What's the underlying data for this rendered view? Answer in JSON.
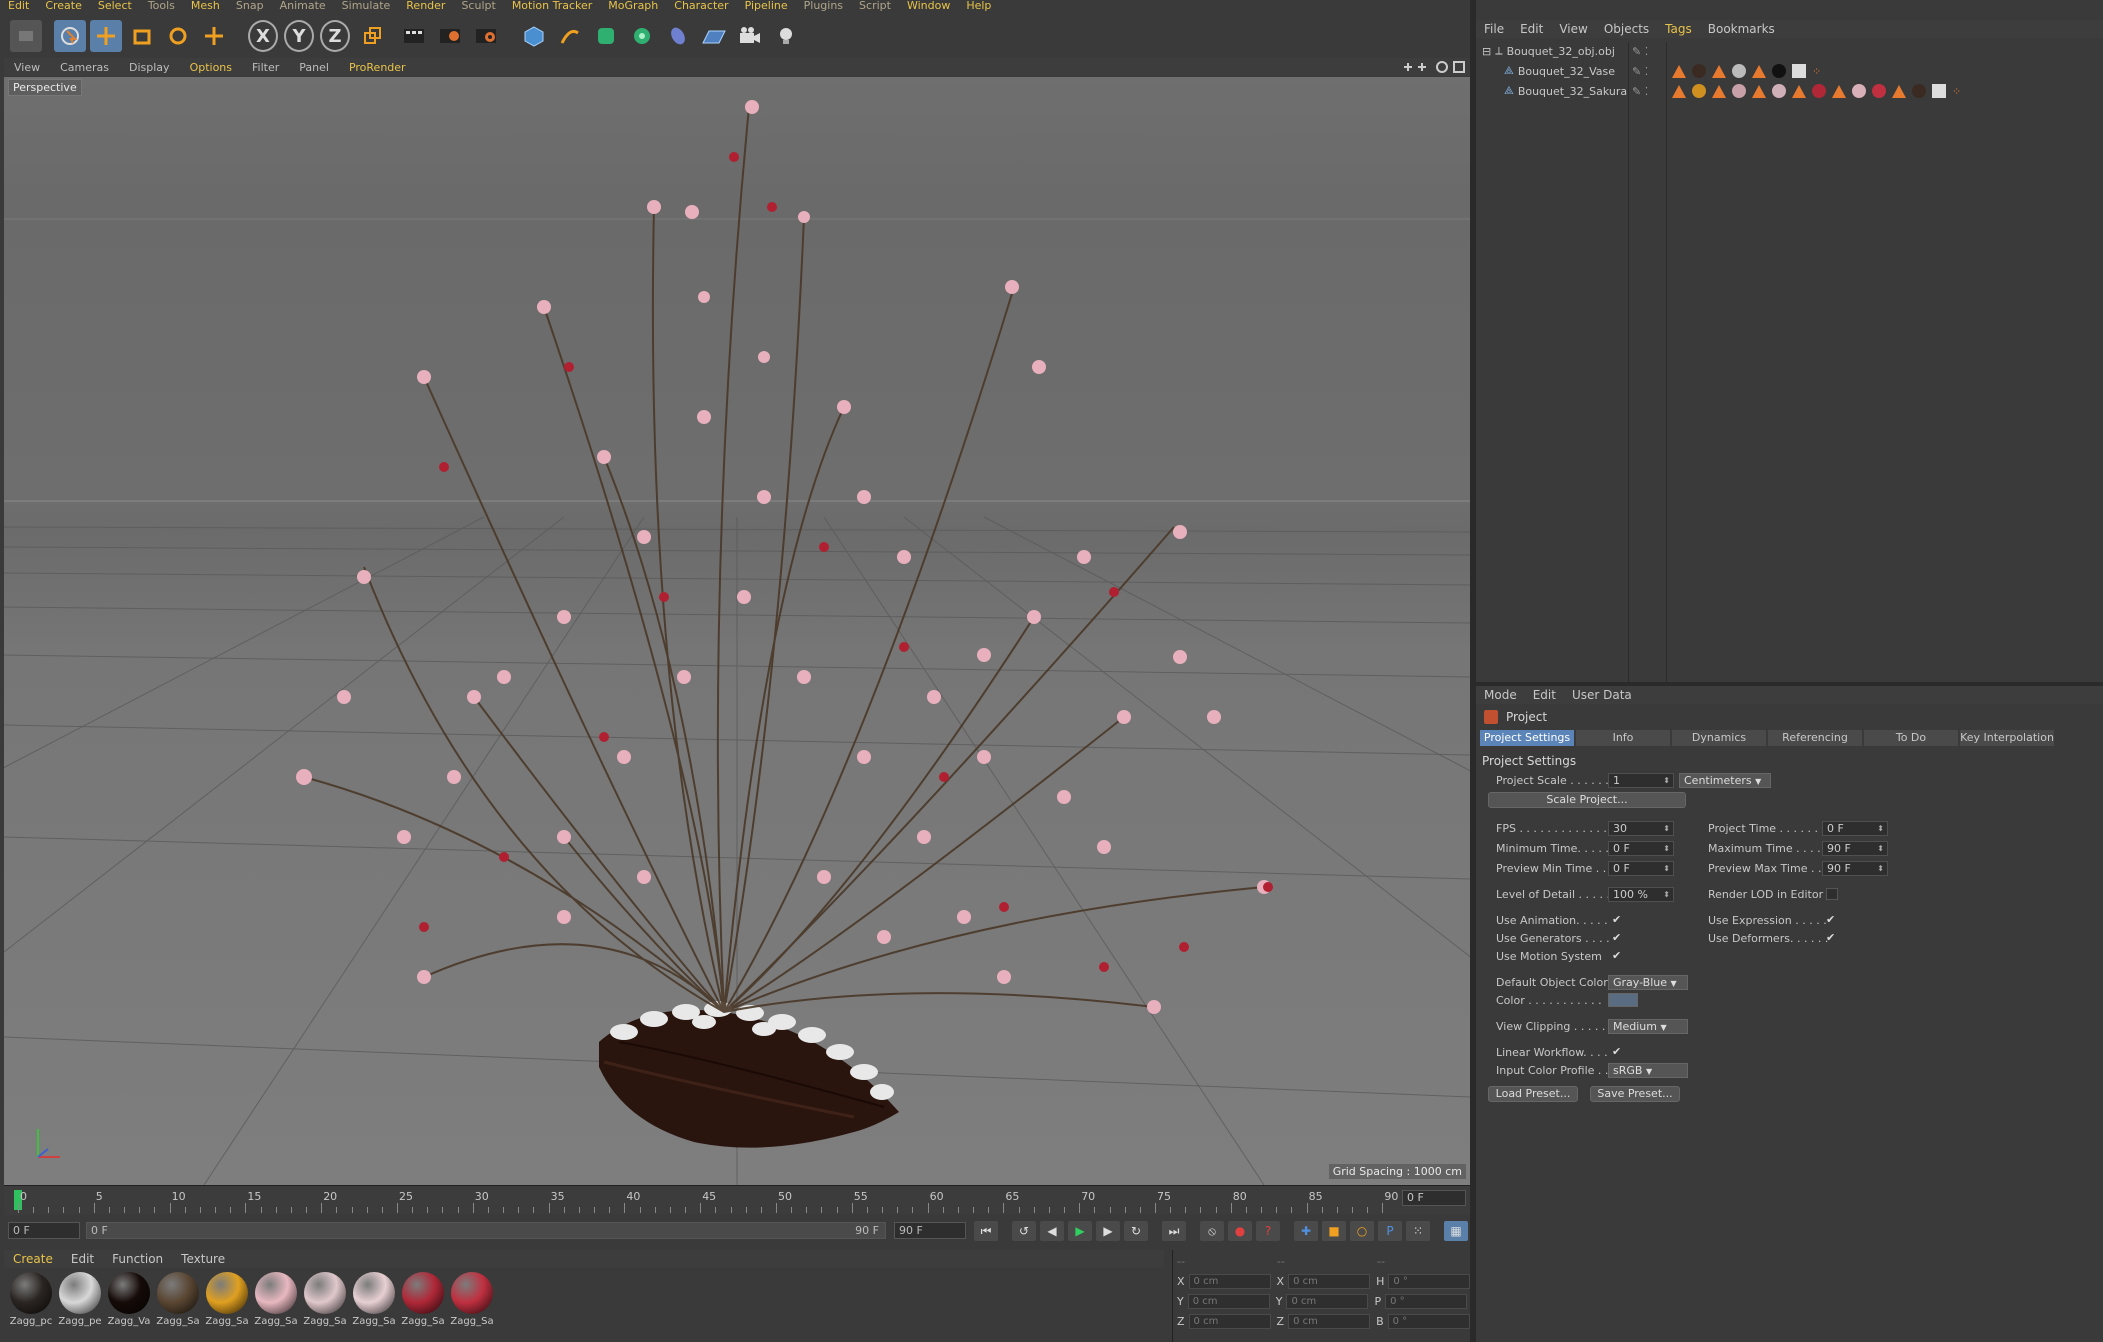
{
  "menu": [
    "Edit",
    "Create",
    "Select",
    "Tools",
    "Mesh",
    "Snap",
    "Animate",
    "Simulate",
    "Render",
    "Sculpt",
    "Motion Tracker",
    "MoGraph",
    "Character",
    "Pipeline",
    "Plugins",
    "Script",
    "Window",
    "Help"
  ],
  "toolbar": {
    "axis_x": "X",
    "axis_y": "Y",
    "axis_z": "Z"
  },
  "viewport": {
    "menu": [
      "View",
      "Cameras",
      "Display",
      "Options",
      "Filter",
      "Panel",
      "ProRender"
    ],
    "label": "Perspective",
    "grid_spacing": "Grid Spacing : 1000 cm"
  },
  "timeline": {
    "ticks": [
      "0",
      "5",
      "10",
      "15",
      "20",
      "25",
      "30",
      "35",
      "40",
      "45",
      "50",
      "55",
      "60",
      "65",
      "70",
      "75",
      "80",
      "85",
      "90"
    ],
    "current_frame": "0 F"
  },
  "transport": {
    "start": "0 F",
    "range_start": "0 F",
    "range_end": "90 F",
    "end": "90 F"
  },
  "materials": {
    "menu": [
      "Create",
      "Edit",
      "Function",
      "Texture"
    ],
    "items": [
      {
        "name": "Zagg_pc",
        "color": "#2a2522"
      },
      {
        "name": "Zagg_pe",
        "color": "#d8d8d8"
      },
      {
        "name": "Zagg_Va",
        "color": "#150b08"
      },
      {
        "name": "Zagg_Sa",
        "color": "#5a4632"
      },
      {
        "name": "Zagg_Sa",
        "color": "#e0a020"
      },
      {
        "name": "Zagg_Sa",
        "color": "#e8b8c0"
      },
      {
        "name": "Zagg_Sa",
        "color": "#e0c8cc"
      },
      {
        "name": "Zagg_Sa",
        "color": "#e8d0d4"
      },
      {
        "name": "Zagg_Sa",
        "color": "#b02838"
      },
      {
        "name": "Zagg_Sa",
        "color": "#c03040"
      }
    ]
  },
  "coords": {
    "header": [
      "--",
      "--",
      "--"
    ],
    "rows": [
      {
        "a": "X",
        "av": "0 cm",
        "b": "X",
        "bv": "0 cm",
        "c": "H",
        "cv": "0 °"
      },
      {
        "a": "Y",
        "av": "0 cm",
        "b": "Y",
        "bv": "0 cm",
        "c": "P",
        "cv": "0 °"
      },
      {
        "a": "Z",
        "av": "0 cm",
        "b": "Z",
        "bv": "0 cm",
        "c": "B",
        "cv": "0 °"
      }
    ]
  },
  "object_manager": {
    "menu": [
      "File",
      "Edit",
      "View",
      "Objects",
      "Tags",
      "Bookmarks"
    ],
    "objects": [
      {
        "name": "Bouquet_32_obj.obj"
      },
      {
        "name": "Bouquet_32_Vase"
      },
      {
        "name": "Bouquet_32_Sakura"
      }
    ]
  },
  "attributes": {
    "menu": [
      "Mode",
      "Edit",
      "User Data"
    ],
    "title": "Project",
    "tabs": [
      "Project Settings",
      "Info",
      "Dynamics",
      "Referencing",
      "To Do",
      "Key Interpolation"
    ],
    "section": "Project Settings",
    "project_scale_label": "Project Scale . . . . . .",
    "project_scale_value": "1",
    "project_scale_unit": "Centimeters",
    "scale_project_btn": "Scale Project...",
    "fps_label": "FPS . . . . . . . . . . . . . .",
    "fps": "30",
    "project_time_label": "Project Time . . . . . . .",
    "project_time": "0 F",
    "min_time_label": "Minimum Time. . . . .",
    "min_time": "0 F",
    "max_time_label": "Maximum Time . . . .",
    "max_time": "90 F",
    "prev_min_label": "Preview Min Time . .",
    "prev_min": "0 F",
    "prev_max_label": "Preview Max Time . .",
    "prev_max": "90 F",
    "lod_label": "Level of Detail . . . . .",
    "lod": "100 %",
    "render_lod_label": "Render LOD in Editor",
    "use_anim_label": "Use Animation. . . . .",
    "use_expr_label": "Use Expression . . . . .",
    "use_gen_label": "Use Generators . . . .",
    "use_def_label": "Use Deformers. . . . . .",
    "use_motion_label": "Use Motion System",
    "def_obj_color_label": "Default Object Color",
    "def_obj_color": "Gray-Blue",
    "color_label": "Color . . . . . . . . . . .",
    "view_clip_label": "View Clipping . . . . .",
    "view_clip": "Medium",
    "linear_wf_label": "Linear Workflow. . . .",
    "input_profile_label": "Input Color Profile . .",
    "input_profile": "sRGB",
    "load_preset": "Load Preset...",
    "save_preset": "Save Preset..."
  }
}
